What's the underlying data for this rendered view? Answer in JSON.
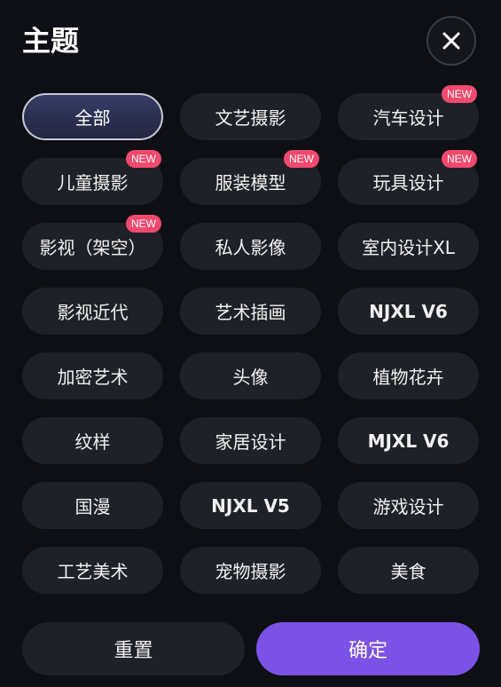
{
  "header": {
    "title": "主题"
  },
  "colors": {
    "background": "#0e0f14",
    "chip": "#1f2128",
    "badge": "#f24a6e",
    "accent": "#7a52e6",
    "selected": "#363c66"
  },
  "badge_label": "NEW",
  "categories": [
    {
      "label": "全部",
      "selected": true,
      "badge": false,
      "bold": false
    },
    {
      "label": "文艺摄影",
      "selected": false,
      "badge": false,
      "bold": false
    },
    {
      "label": "汽车设计",
      "selected": false,
      "badge": true,
      "bold": false
    },
    {
      "label": "儿童摄影",
      "selected": false,
      "badge": true,
      "bold": false
    },
    {
      "label": "服装模型",
      "selected": false,
      "badge": true,
      "bold": false
    },
    {
      "label": "玩具设计",
      "selected": false,
      "badge": true,
      "bold": false
    },
    {
      "label": "影视（架空）",
      "selected": false,
      "badge": true,
      "bold": false
    },
    {
      "label": "私人影像",
      "selected": false,
      "badge": false,
      "bold": false
    },
    {
      "label": "室内设计XL",
      "selected": false,
      "badge": false,
      "bold": false
    },
    {
      "label": "影视近代",
      "selected": false,
      "badge": false,
      "bold": false
    },
    {
      "label": "艺术插画",
      "selected": false,
      "badge": false,
      "bold": false
    },
    {
      "label": "NJXL V6",
      "selected": false,
      "badge": false,
      "bold": true
    },
    {
      "label": "加密艺术",
      "selected": false,
      "badge": false,
      "bold": false
    },
    {
      "label": "头像",
      "selected": false,
      "badge": false,
      "bold": false
    },
    {
      "label": "植物花卉",
      "selected": false,
      "badge": false,
      "bold": false
    },
    {
      "label": "纹样",
      "selected": false,
      "badge": false,
      "bold": false
    },
    {
      "label": "家居设计",
      "selected": false,
      "badge": false,
      "bold": false
    },
    {
      "label": "MJXL V6",
      "selected": false,
      "badge": false,
      "bold": true
    },
    {
      "label": "国漫",
      "selected": false,
      "badge": false,
      "bold": false
    },
    {
      "label": "NJXL V5",
      "selected": false,
      "badge": false,
      "bold": true
    },
    {
      "label": "游戏设计",
      "selected": false,
      "badge": false,
      "bold": false
    },
    {
      "label": "工艺美术",
      "selected": false,
      "badge": false,
      "bold": false
    },
    {
      "label": "宠物摄影",
      "selected": false,
      "badge": false,
      "bold": false
    },
    {
      "label": "美食",
      "selected": false,
      "badge": false,
      "bold": false
    }
  ],
  "footer": {
    "reset_label": "重置",
    "confirm_label": "确定"
  },
  "icons": {
    "close": "close-icon"
  }
}
